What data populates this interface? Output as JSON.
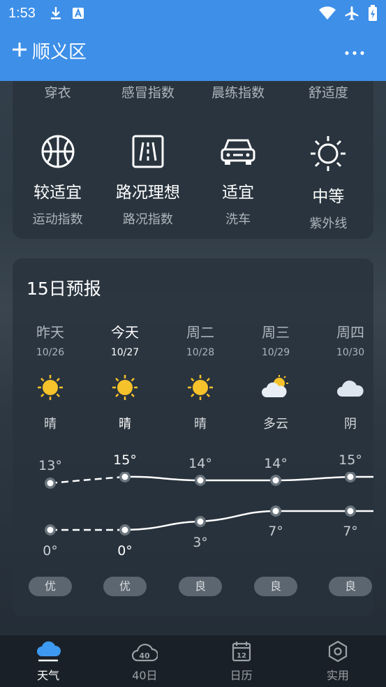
{
  "status_bar": {
    "time": "1:53"
  },
  "header": {
    "add_icon": "plus-icon",
    "city": "顺义区",
    "more_icon": "more-dots-icon"
  },
  "index_top_labels": [
    "穿衣",
    "感冒指数",
    "晨练指数",
    "舒适度"
  ],
  "indices": [
    {
      "icon": "basketball-icon",
      "value": "较适宜",
      "label": "运动指数"
    },
    {
      "icon": "road-icon",
      "value": "路况理想",
      "label": "路况指数"
    },
    {
      "icon": "car-icon",
      "value": "适宜",
      "label": "洗车"
    },
    {
      "icon": "sun-outline-icon",
      "value": "中等",
      "label": "紫外线"
    }
  ],
  "forecast": {
    "title": "15日预报",
    "days": [
      {
        "name": "昨天",
        "date": "10/26",
        "icon": "sun-icon",
        "cond": "晴",
        "high": "13°",
        "low": "0°",
        "aqi": "优",
        "today": false
      },
      {
        "name": "今天",
        "date": "10/27",
        "icon": "sun-icon",
        "cond": "晴",
        "high": "15°",
        "low": "0°",
        "aqi": "优",
        "today": true
      },
      {
        "name": "周二",
        "date": "10/28",
        "icon": "sun-icon",
        "cond": "晴",
        "high": "14°",
        "low": "3°",
        "aqi": "良",
        "today": false
      },
      {
        "name": "周三",
        "date": "10/29",
        "icon": "partly-cloudy-icon",
        "cond": "多云",
        "high": "14°",
        "low": "7°",
        "aqi": "良",
        "today": false
      },
      {
        "name": "周四",
        "date": "10/30",
        "icon": "cloud-icon",
        "cond": "阴",
        "high": "15°",
        "low": "7°",
        "aqi": "良",
        "today": false
      }
    ]
  },
  "bottom_nav": [
    {
      "icon": "weather-cloud-icon",
      "label": "天气",
      "active": true
    },
    {
      "icon": "forty-day-icon",
      "label": "40日",
      "active": false
    },
    {
      "icon": "calendar-icon",
      "label": "日历",
      "active": false
    },
    {
      "icon": "tools-hexagon-icon",
      "label": "实用",
      "active": false
    }
  ]
}
